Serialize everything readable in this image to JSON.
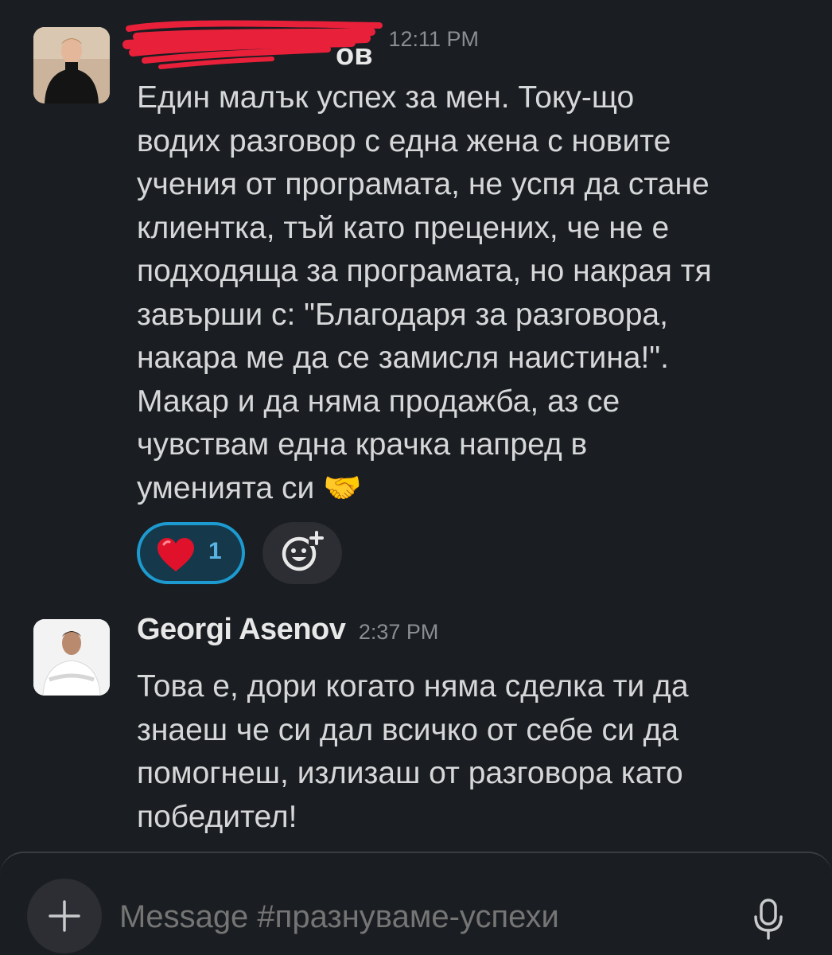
{
  "channel": {
    "placeholder": "Message #празнуваме-успехи"
  },
  "messages": [
    {
      "sender": "Г. Ганов",
      "sender_visible_fragment": "ов",
      "sender_redacted": true,
      "time": "12:11 PM",
      "lines": [
        "Един малък успех за мен. Току-що",
        "водих разговор с една жена с новите",
        "учения от програмата, не успя да стане",
        "клиентка, тъй като прецених, че не е",
        "подходяща за програмата, но накрая тя",
        "завърши с: \"Благодаря за разговора,",
        "накара ме да се замисля наистина!\".",
        "Макар и да няма продажба, аз се",
        "чувствам една крачка напред в",
        "уменията си 🤝"
      ],
      "reactions": [
        {
          "emoji": "heart",
          "count": "1"
        }
      ]
    },
    {
      "sender": "Georgi Asenov",
      "time": "2:37 PM",
      "lines": [
        "Това е, дори когато няма сделка ти да",
        "знаеш че си дал всичко от себе си да",
        "помогнеш, излизаш от разговора като",
        "победител!"
      ]
    }
  ],
  "icons": {
    "add_reaction": "add-emoji-icon",
    "composer_plus": "plus-icon",
    "composer_mic": "microphone-icon"
  },
  "colors": {
    "background": "#1a1d21",
    "reaction_border": "#1d9bd1",
    "redaction": "#e8203a"
  }
}
